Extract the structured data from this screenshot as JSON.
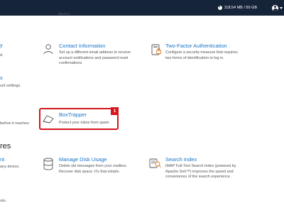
{
  "topbar": {
    "storage": "118.54 MB / 50 GB",
    "storage_used_fraction": 0.0024
  },
  "left_fragments": {
    "top_title": "y",
    "top_desc_1": "d.",
    "top_desc_2": "",
    "mid_title": "s",
    "mid_desc": "unt settings.",
    "reaches": "before it reaches",
    "section": "res",
    "bottom_title": "nt",
    "bottom_desc": "any device.",
    "bottom_small": "ute."
  },
  "top_fragment": "device.",
  "items": {
    "contact": {
      "title": "Contact Information",
      "desc_1": "Set up a different email address to receive",
      "desc_2": "account notifications and password reset",
      "desc_3": "confirmations."
    },
    "twofactor": {
      "title": "Two-Factor Authentication",
      "desc_1": "Configure a security measure that requires",
      "desc_2": "two forms of identification to log in."
    },
    "boxtrapper": {
      "title": "BoxTrapper",
      "desc_1": "Protect your inbox from spam.",
      "badge": "1"
    },
    "disk": {
      "title": "Manage Disk Usage",
      "desc_1": "Delete old messages from your mailbox.",
      "desc_2": "Recover disk space. It's that simple."
    },
    "search": {
      "title": "Search Index",
      "desc_1": "IMAP Full-Text Search Index (powered by",
      "desc_2": "Apache Solr™) improves the speed and",
      "desc_3": "convenience of the search experience."
    }
  }
}
